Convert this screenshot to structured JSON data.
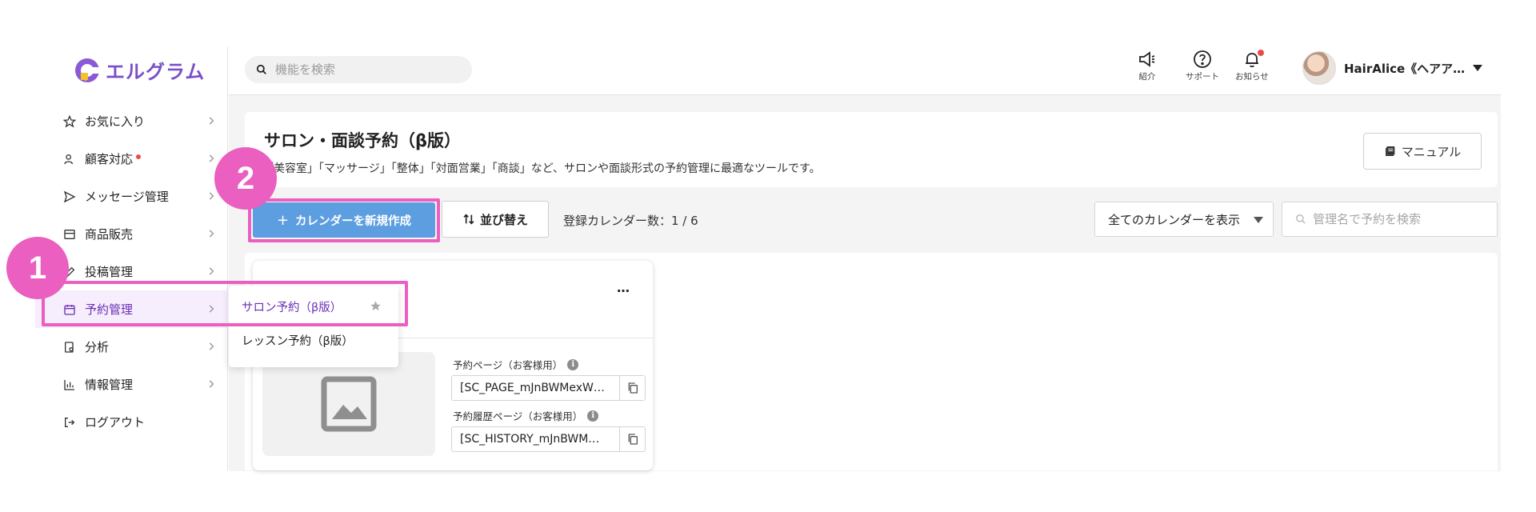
{
  "app": {
    "logo_text": "エルグラム",
    "brand_color": "#7a4fc9"
  },
  "search": {
    "placeholder": "機能を検索"
  },
  "top_icons": [
    {
      "icon": "megaphone-icon",
      "label": "紹介"
    },
    {
      "icon": "help-circle-icon",
      "label": "サポート"
    },
    {
      "icon": "bell-icon",
      "label": "お知らせ",
      "has_dot": true
    }
  ],
  "user": {
    "name": "HairAlice《ヘアア…"
  },
  "sidebar": {
    "items": [
      {
        "icon": "star-icon",
        "label": "お気に入り"
      },
      {
        "icon": "customer-icon",
        "label": "顧客対応",
        "has_dot": true
      },
      {
        "icon": "send-icon",
        "label": "メッセージ管理"
      },
      {
        "icon": "store-icon",
        "label": "商品販売"
      },
      {
        "icon": "post-icon",
        "label": "投稿管理"
      },
      {
        "icon": "calendar-icon",
        "label": "予約管理",
        "active": true
      },
      {
        "icon": "report-icon",
        "label": "分析"
      },
      {
        "icon": "bar-chart-icon",
        "label": "情報管理"
      },
      {
        "icon": "logout-icon",
        "label": "ログアウト"
      }
    ]
  },
  "submenu": {
    "items": [
      {
        "label": "サロン予約（β版）",
        "selected": true
      },
      {
        "label": "レッスン予約（β版）"
      }
    ]
  },
  "page": {
    "title": "サロン・面談予約（β版）",
    "description": "「美容室」「マッサージ」「整体」「対面営業」「商談」など、サロンや面談形式の予約管理に最適なツールです。",
    "manual_label": "マニュアル"
  },
  "actions": {
    "create_label": "カレンダーを新規作成",
    "sort_label": "並び替え",
    "count_text": "登録カレンダー数：1 / 6",
    "filter_value": "全てのカレンダーを表示",
    "search_placeholder": "管理名で予約を検索"
  },
  "calendar_card": {
    "more_label": "…",
    "fields": [
      {
        "label": "予約ページ（お客様用）",
        "value": "[SC_PAGE_mJnBWMexW…"
      },
      {
        "label": "予約履歴ページ（お客様用）",
        "value": "[SC_HISTORY_mJnBWM…"
      }
    ]
  },
  "annotations": {
    "badge_1": "1",
    "badge_2": "2",
    "highlight_color": "#ea5fbf"
  }
}
